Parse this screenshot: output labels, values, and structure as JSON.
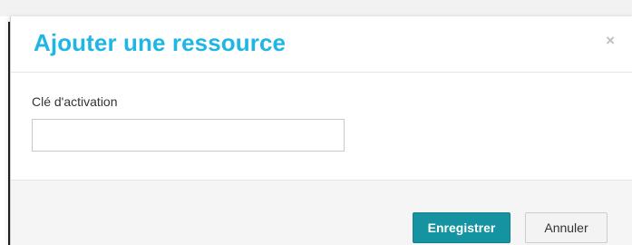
{
  "modal": {
    "title": "Ajouter une ressource",
    "close_symbol": "×",
    "close_icon": "close-icon"
  },
  "form": {
    "activation_key_label": "Clé d'activation",
    "activation_key_value": "",
    "activation_key_placeholder": ""
  },
  "footer": {
    "save_label": "Enregistrer",
    "cancel_label": "Annuler"
  },
  "colors": {
    "title": "#1fb6e6",
    "primary_button": "#1593a0",
    "footer_background": "#f5f5f5"
  }
}
